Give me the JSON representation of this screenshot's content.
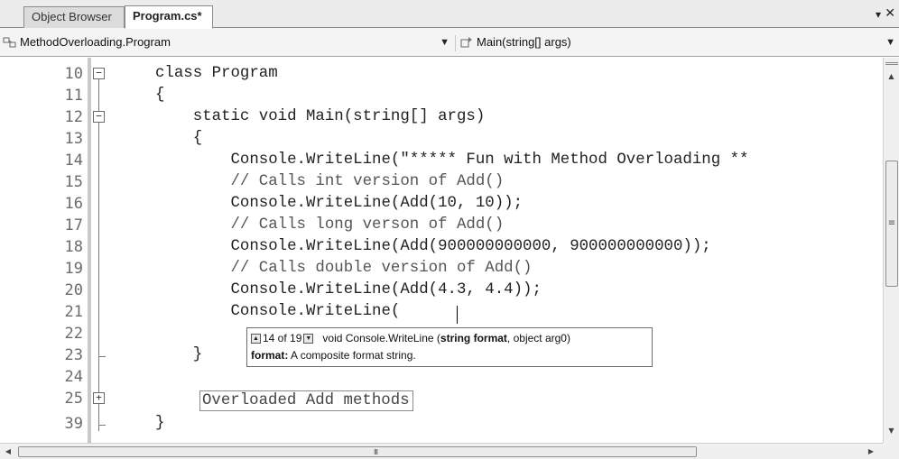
{
  "tabs": [
    {
      "label": "Object Browser",
      "active": false
    },
    {
      "label": "Program.cs*",
      "active": true
    }
  ],
  "tab_controls": {
    "dropdown_icon": "dropdown-arrow-icon",
    "close_icon": "close-icon",
    "dropdown_glyph": "▾",
    "close_glyph": "✕"
  },
  "navbar": {
    "type_combo": {
      "icon": "class-icon",
      "value": "MethodOverloading.Program"
    },
    "member_combo": {
      "icon": "method-icon",
      "value": "Main(string[] args)"
    }
  },
  "editor": {
    "lines": [
      {
        "number": "10",
        "code": "class Program"
      },
      {
        "number": "11",
        "code": "{"
      },
      {
        "number": "12",
        "code": "    static void Main(string[] args)"
      },
      {
        "number": "13",
        "code": "    {"
      },
      {
        "number": "14",
        "code": "        Console.WriteLine(\"***** Fun with Method Overloading **"
      },
      {
        "number": "15",
        "code": "        // Calls int version of Add()"
      },
      {
        "number": "16",
        "code": "        Console.WriteLine(Add(10, 10));"
      },
      {
        "number": "17",
        "code": "        // Calls long verson of Add()"
      },
      {
        "number": "18",
        "code": "        Console.WriteLine(Add(900000000000, 900000000000));"
      },
      {
        "number": "19",
        "code": "        // Calls double version of Add()"
      },
      {
        "number": "20",
        "code": "        Console.WriteLine(Add(4.3, 4.4));"
      },
      {
        "number": "21",
        "code": "        Console.WriteLine("
      },
      {
        "number": "22",
        "code": ""
      },
      {
        "number": "23",
        "code": "    }"
      },
      {
        "number": "24",
        "code": ""
      },
      {
        "number": "25",
        "code": ""
      },
      {
        "number": "39",
        "code": "}"
      }
    ],
    "collapsed_region_label": "Overloaded Add methods"
  },
  "tooltip": {
    "overload_count": "14 of 19",
    "signature_prefix": "void Console.WriteLine (",
    "signature_bold": "string format",
    "signature_suffix": ", object arg0)",
    "param_name": "format:",
    "param_description": "A composite format string.",
    "up_glyph": "▲",
    "down_glyph": "▼"
  },
  "scrollbars": {
    "vertical": {
      "up_glyph": "▲",
      "down_glyph": "▼",
      "grip_glyph": "≡"
    },
    "horizontal": {
      "left_glyph": "◀",
      "right_glyph": "▶",
      "grip_glyph": "III"
    }
  }
}
